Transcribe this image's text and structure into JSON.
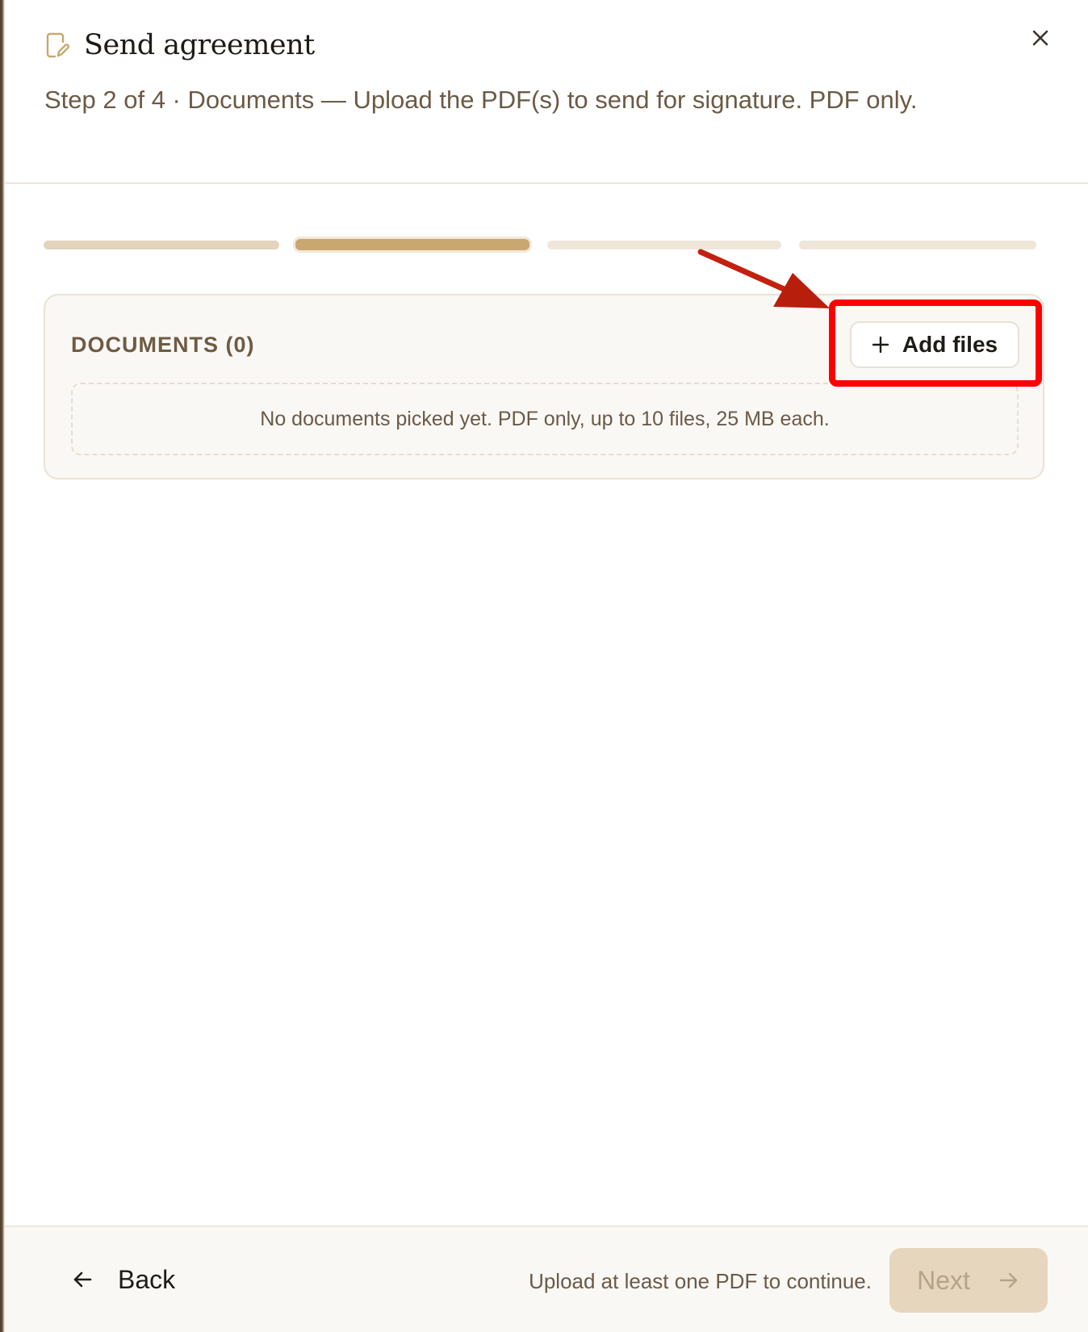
{
  "dialog": {
    "title": "Send agreement",
    "subtitle": "Step 2 of 4 · Documents — Upload the PDF(s) to send for signature. PDF only.",
    "icon": "document-edit-icon",
    "close_icon": "close-icon"
  },
  "progress": {
    "current_step": 2,
    "total_steps": 4,
    "steps": [
      "done",
      "active",
      "todo",
      "todo"
    ]
  },
  "documents": {
    "heading": "DOCUMENTS (0)",
    "add_label": "Add files",
    "add_icon": "plus-icon",
    "empty_text": "No documents picked yet. PDF only, up to 10 files, 25 MB each."
  },
  "footer": {
    "back_label": "Back",
    "back_icon": "arrow-left-icon",
    "hint": "Upload at least one PDF to continue.",
    "next_label": "Next",
    "next_icon": "arrow-right-icon"
  },
  "colors": {
    "accent": "#c8a771",
    "annotation": "#ff0000",
    "next_disabled_bg": "#e6d6be"
  }
}
